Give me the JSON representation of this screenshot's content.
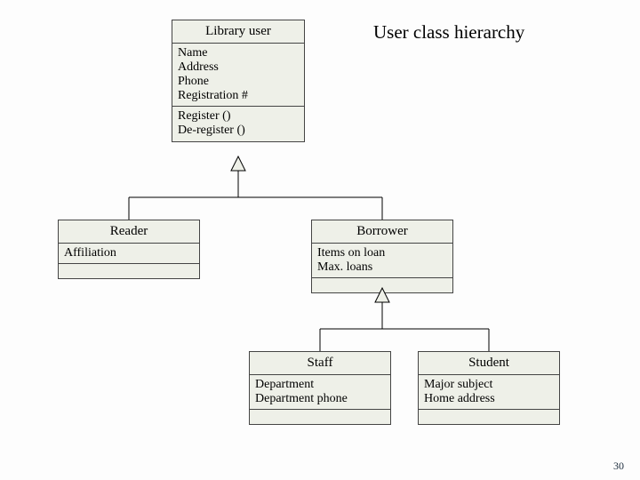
{
  "title": "User class hierarchy",
  "page_number": "30",
  "classes": {
    "library_user": {
      "name": "Library user",
      "attrs": [
        "Name",
        "Address",
        "Phone",
        "Registration #"
      ],
      "ops": [
        "Register ()",
        "De-register ()"
      ]
    },
    "reader": {
      "name": "Reader",
      "attrs": [
        "Affiliation"
      ]
    },
    "borrower": {
      "name": "Borrower",
      "attrs": [
        "Items on loan",
        "Max. loans"
      ]
    },
    "staff": {
      "name": "Staff",
      "attrs": [
        "Department",
        "Department phone"
      ]
    },
    "student": {
      "name": "Student",
      "attrs": [
        "Major subject",
        "Home address"
      ]
    }
  }
}
